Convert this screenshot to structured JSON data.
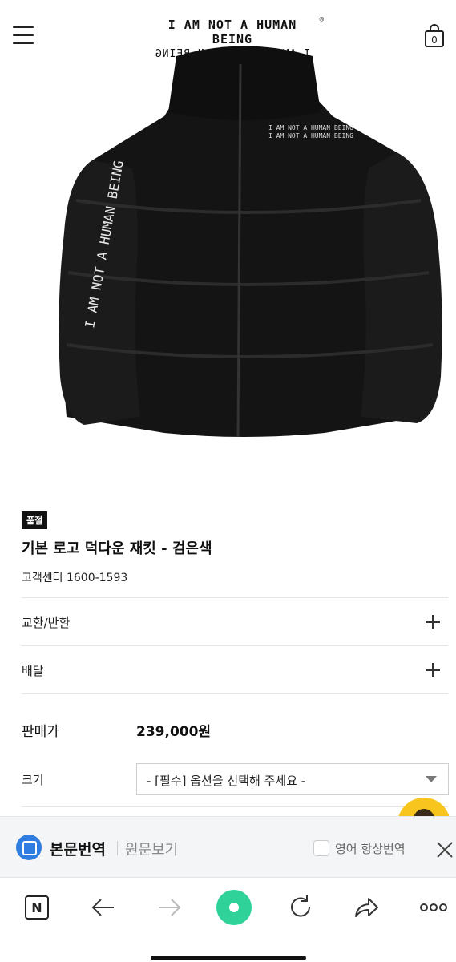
{
  "header": {
    "logo_line1": "I AM NOT A HUMAN BEING",
    "logo_line2": "I AM NOT A HUMAN BEING",
    "logo_reg": "®",
    "menu_icon": "hamburger-icon",
    "bag_icon": "shopping-bag-icon",
    "bag_count": "0"
  },
  "product": {
    "badge": "품절",
    "title": "기본 로고 덕다운 재킷 - 검은색",
    "customer_center": "고객센터 1600-1593",
    "print_line1": "I AM NOT A HUMAN BEING",
    "print_line2": "I AM NOT A HUMAN BEING"
  },
  "accordion": {
    "exchange_label": "교환/반환",
    "delivery_label": "배달"
  },
  "price": {
    "label": "판매가",
    "value": "239,000원"
  },
  "option": {
    "size_label": "크기",
    "select_value": "- [필수] 옵션을 선택해 주세요 -"
  },
  "translate_bar": {
    "main_label": "본문번역",
    "original_label": "원문보기",
    "always_label": "영어 항상번역"
  },
  "browser": {
    "n_label": "N"
  }
}
